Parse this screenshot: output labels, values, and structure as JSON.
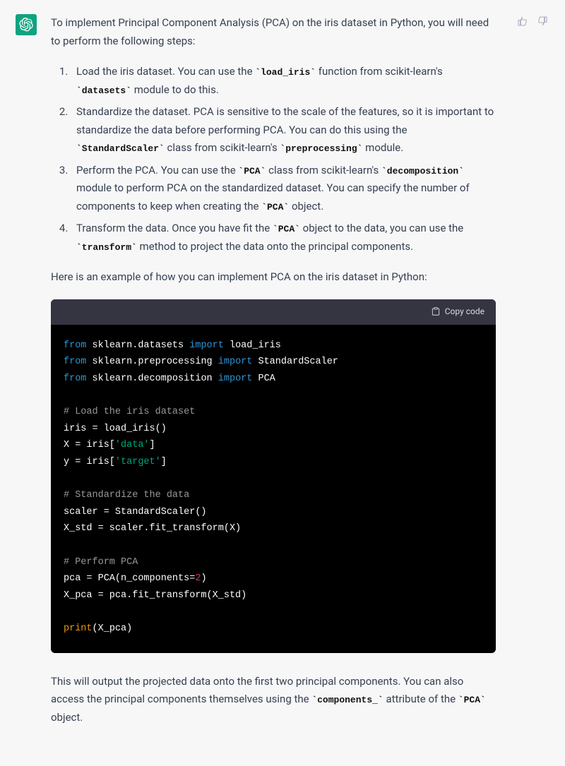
{
  "intro": "To implement Principal Component Analysis (PCA) on the iris dataset in Python, you will need to perform the following steps:",
  "steps": {
    "s1_pre": "Load the iris dataset. You can use the ",
    "s1_c1": "`load_iris`",
    "s1_mid": " function from scikit-learn's ",
    "s1_c2": "`datasets`",
    "s1_post": " module to do this.",
    "s2_pre": "Standardize the dataset. PCA is sensitive to the scale of the features, so it is important to standardize the data before performing PCA. You can do this using the ",
    "s2_c1": "`StandardScaler`",
    "s2_mid": " class from scikit-learn's ",
    "s2_c2": "`preprocessing`",
    "s2_post": " module.",
    "s3_pre": "Perform the PCA. You can use the ",
    "s3_c1": "`PCA`",
    "s3_mid": " class from scikit-learn's ",
    "s3_c2": "`decomposition`",
    "s3_mid2": " module to perform PCA on the standardized dataset. You can specify the number of components to keep when creating the ",
    "s3_c3": "`PCA`",
    "s3_post": " object.",
    "s4_pre": "Transform the data. Once you have fit the ",
    "s4_c1": "`PCA`",
    "s4_mid": " object to the data, you can use the ",
    "s4_c2": "`transform`",
    "s4_post": " method to project the data onto the principal components."
  },
  "example_intro": "Here is an example of how you can implement PCA on the iris dataset in Python:",
  "copy_label": "Copy code",
  "code": {
    "from": "from",
    "import": "import",
    "mod1": "sklearn.datasets",
    "imp1": "load_iris",
    "mod2": "sklearn.preprocessing",
    "imp2": "StandardScaler",
    "mod3": "sklearn.decomposition",
    "imp3": "PCA",
    "c1": "# Load the iris dataset",
    "l1": "iris = load_iris()",
    "l2a": "X = iris[",
    "l2b": "'data'",
    "l2c": "]",
    "l3a": "y = iris[",
    "l3b": "'target'",
    "l3c": "]",
    "c2": "# Standardize the data",
    "l4": "scaler = StandardScaler()",
    "l5": "X_std = scaler.fit_transform(X)",
    "c3": "# Perform PCA",
    "l6a": "pca = PCA(n_components=",
    "l6b": "2",
    "l6c": ")",
    "l7": "X_pca = pca.fit_transform(X_std)",
    "print": "print",
    "l8": "(X_pca)"
  },
  "outro_pre": "This will output the projected data onto the first two principal components. You can also access the principal components themselves using the ",
  "outro_c1": "`components_`",
  "outro_mid": " attribute of the ",
  "outro_c2": "`PCA`",
  "outro_post": " object."
}
